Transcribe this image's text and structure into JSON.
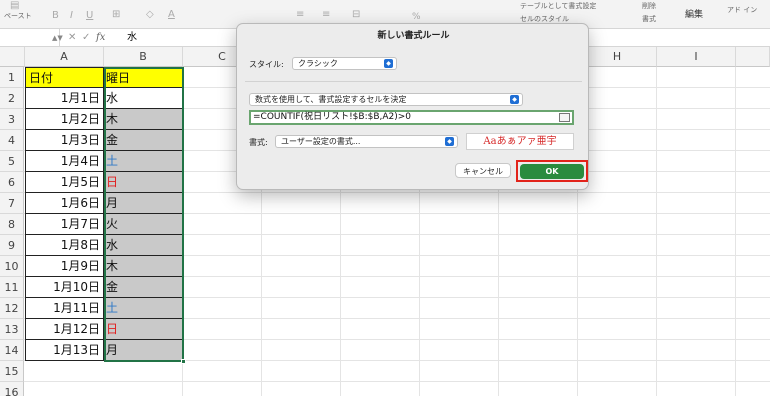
{
  "ribbon": {
    "paste_label": "ペースト",
    "table_format_label": "テーブルとして書式設定",
    "cell_styles_label": "セルのスタイル",
    "delete_label": "削除",
    "format_label": "書式",
    "edit_label": "編集",
    "addin_label": "アド\nイン",
    "percent_symbol": "%"
  },
  "formula_bar": {
    "cell_value": "水",
    "fx_symbol": "fx"
  },
  "columns": [
    "A",
    "B",
    "C",
    "D",
    "E",
    "F",
    "G",
    "H",
    "I"
  ],
  "rows": [
    "1",
    "2",
    "3",
    "4",
    "5",
    "6",
    "7",
    "8",
    "9",
    "10",
    "11",
    "12",
    "13",
    "14",
    "15",
    "16"
  ],
  "sheet": {
    "header_A": "日付",
    "header_B": "曜日",
    "dates": [
      "1月1日",
      "1月2日",
      "1月3日",
      "1月4日",
      "1月5日",
      "1月6日",
      "1月7日",
      "1月8日",
      "1月9日",
      "1月10日",
      "1月11日",
      "1月12日",
      "1月13日"
    ],
    "weekdays": [
      "水",
      "木",
      "金",
      "土",
      "日",
      "月",
      "火",
      "水",
      "木",
      "金",
      "土",
      "日",
      "月"
    ]
  },
  "dialog": {
    "title": "新しい書式ルール",
    "style_label": "スタイル:",
    "style_value": "クラシック",
    "rule_type": "数式を使用して、書式設定するセルを決定",
    "formula": "=COUNTIF(祝日リスト!$B:$B,A2)>0",
    "format_label": "書式:",
    "format_value": "ユーザー設定の書式...",
    "preview_text": "Aaあぁアァ亜宇",
    "cancel_label": "キャンセル",
    "ok_label": "OK"
  },
  "colors": {
    "header_fill": "#ffff00",
    "formatted_fill": "#c9c9c9",
    "saturday_text": "#2f79c8",
    "holiday_text": "#e02020",
    "selection": "#217346",
    "ok_button": "#2a8b3e",
    "highlight": "#e2231a"
  }
}
